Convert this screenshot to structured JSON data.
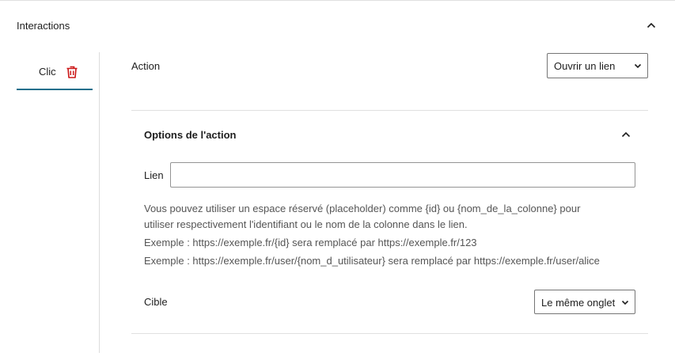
{
  "panel": {
    "title": "Interactions"
  },
  "tabs": [
    {
      "label": "Clic"
    }
  ],
  "action": {
    "label": "Action",
    "selected": "Ouvrir un lien"
  },
  "options": {
    "title": "Options de l'action",
    "link_label": "Lien",
    "link_value": "",
    "help_line1": "Vous pouvez utiliser un espace réservé (placeholder) comme {id} ou {nom_de_la_colonne} pour",
    "help_line2": "utiliser respectivement l'identifiant ou le nom de la colonne dans le lien.",
    "example1": "Exemple : https://exemple.fr/{id} sera remplacé par https://exemple.fr/123",
    "example2": "Exemple : https://exemple.fr/user/{nom_d_utilisateur} sera remplacé par https://exemple.fr/user/alice",
    "target_label": "Cible",
    "target_selected": "Le même onglet"
  },
  "icons": {
    "collapse": "chevron-up-icon",
    "delete": "trash-icon",
    "dropdown": "chevron-down-icon"
  },
  "colors": {
    "accent": "#1e6f8c",
    "danger": "#cc1818"
  }
}
